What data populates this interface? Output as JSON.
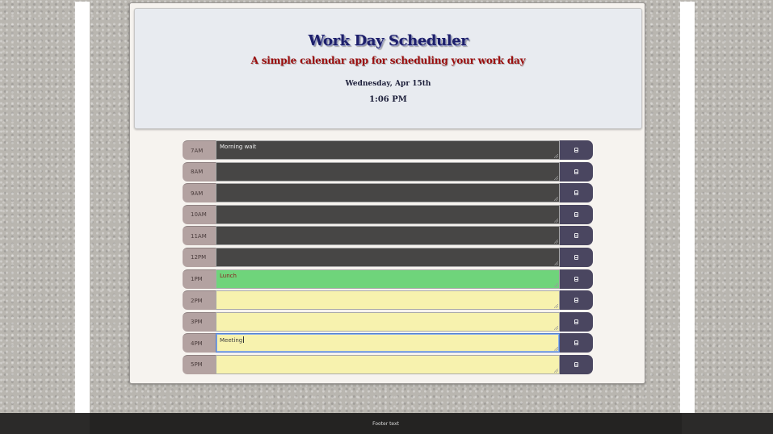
{
  "header": {
    "title": "Work Day Scheduler",
    "subtitle": "A simple calendar app for scheduling your work day",
    "date": "Wednesday, Apr 15th",
    "time": "1:06 PM"
  },
  "rows": [
    {
      "hour": "7AM",
      "text": "Morning wait",
      "state": "past"
    },
    {
      "hour": "8AM",
      "text": "",
      "state": "past"
    },
    {
      "hour": "9AM",
      "text": "",
      "state": "past"
    },
    {
      "hour": "10AM",
      "text": "",
      "state": "past"
    },
    {
      "hour": "11AM",
      "text": "",
      "state": "past"
    },
    {
      "hour": "12PM",
      "text": "",
      "state": "past"
    },
    {
      "hour": "1PM",
      "text": "Lunch",
      "state": "present"
    },
    {
      "hour": "2PM",
      "text": "",
      "state": "future"
    },
    {
      "hour": "3PM",
      "text": "",
      "state": "future"
    },
    {
      "hour": "4PM",
      "text": "Meeting",
      "state": "future",
      "focused": true
    },
    {
      "hour": "5PM",
      "text": "",
      "state": "future"
    }
  ],
  "icons": {
    "save": "save-icon"
  },
  "colors": {
    "past": "#474645",
    "present": "#6fd47b",
    "future": "#f7f2ae",
    "save_button": "#4a4660",
    "hour_block": "#b3a2a1",
    "title": "#1d1f6b",
    "subtitle": "#9b0d0d"
  },
  "footer": {
    "text": "Footer text"
  }
}
